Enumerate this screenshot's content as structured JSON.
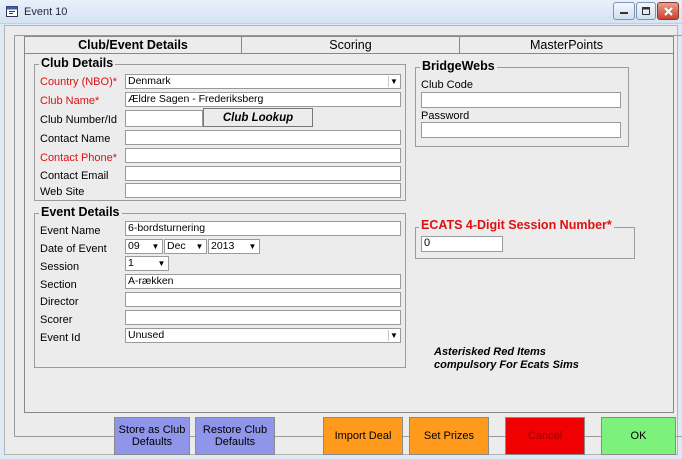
{
  "window": {
    "title": "Event 10"
  },
  "tabs": [
    {
      "label": "Club/Event Details"
    },
    {
      "label": "Scoring"
    },
    {
      "label": "MasterPoints"
    }
  ],
  "club_details": {
    "title": "Club Details",
    "country_label": "Country (NBO)*",
    "country_value": "Denmark",
    "club_name_label": "Club Name*",
    "club_name_value": "Ældre Sagen - Frederiksberg",
    "club_number_label": "Club Number/Id",
    "club_number_value": "",
    "club_lookup_label": "Club Lookup",
    "contact_name_label": "Contact Name",
    "contact_phone_label": "Contact Phone*",
    "contact_email_label": "Contact Email",
    "web_site_label": "Web Site"
  },
  "bridgewebs": {
    "title": "BridgeWebs",
    "club_code_label": "Club Code",
    "password_label": "Password"
  },
  "event_details": {
    "title": "Event Details",
    "event_name_label": "Event Name",
    "event_name_value": "6-bordsturnering",
    "date_label": "Date of Event",
    "date_day": "09",
    "date_month": "Dec",
    "date_year": "2013",
    "session_label": "Session",
    "session_value": "1",
    "section_label": "Section",
    "section_value": "A-rækken",
    "director_label": "Director",
    "scorer_label": "Scorer",
    "event_id_label": "Event Id",
    "event_id_value": "Unused"
  },
  "ecats": {
    "title": "ECATS 4-Digit Session Number*",
    "value": "0",
    "note_line1": "Asterisked Red Items",
    "note_line2": "compulsory For Ecats Sims"
  },
  "buttons": {
    "store_defaults": "Store as Club Defaults",
    "restore_defaults": "Restore Club Defaults",
    "import_deal": "Import Deal",
    "set_prizes": "Set Prizes",
    "cancel": "Cancel",
    "ok": "OK"
  },
  "colors": {
    "store_btn": "#8f95e8",
    "restore_btn": "#8f95e8",
    "import_btn": "#ff9a1c",
    "prizes_btn": "#ff9a1c",
    "cancel_btn": "#f00000",
    "ok_btn": "#7cf27c",
    "required_label": "#dd1111"
  }
}
